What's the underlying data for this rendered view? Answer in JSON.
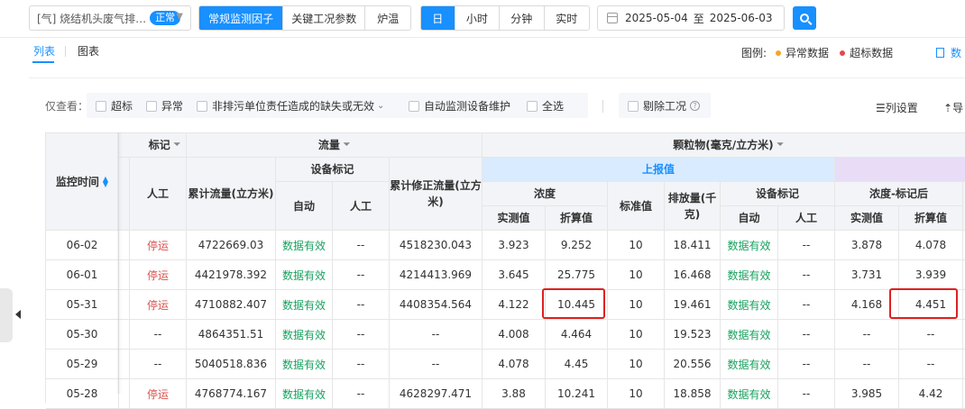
{
  "toolbar": {
    "source_name": "[气] 烧结机头废气排…",
    "source_status": "正常",
    "factor_tabs": [
      "常规监测因子",
      "关键工况参数",
      "炉温"
    ],
    "period_tabs": [
      "日",
      "小时",
      "分钟",
      "实时"
    ],
    "date_start": "2025-05-04",
    "date_sep": "至",
    "date_end": "2025-06-03"
  },
  "view_tabs": {
    "list": "列表",
    "chart": "图表"
  },
  "legend": {
    "title": "图例:",
    "abnormal": "异常数据",
    "exceed": "超标数据",
    "abnormal_color": "#f5a623",
    "exceed_color": "#e5484d"
  },
  "data_link": "数",
  "filters": {
    "label": "仅查看：",
    "items": [
      "超标",
      "异常",
      "非排污单位责任造成的缺失或无效",
      "自动监测设备维护",
      "全选"
    ],
    "exclude": "剔除工况"
  },
  "actions": {
    "column_settings": "列设置",
    "export": "导"
  },
  "table": {
    "headers": {
      "time": "监控时间",
      "mark_partial": "标记",
      "manual": "人工",
      "flow_group": "流量",
      "cum_flow": "累计流量(立方米)",
      "device_mark": "设备标记",
      "auto": "自动",
      "cum_corr_flow": "累计修正流量(立方米)",
      "particle_group": "颗粒物(毫克/立方米)",
      "reported": "上报值",
      "concentration": "浓度",
      "measured": "实测值",
      "converted": "折算值",
      "standard": "标准值",
      "emission": "排放量(千克)",
      "conc_after_mark": "浓度-标记后"
    },
    "rows": [
      {
        "time": "06-02",
        "manual": "停运",
        "cum_flow": "4722669.03",
        "dev_auto": "数据有效",
        "dev_manual": "--",
        "cum_corr": "4518230.043",
        "measured": "3.923",
        "converted": "9.252",
        "standard": "10",
        "emission": "18.411",
        "dev2_auto": "数据有效",
        "dev2_manual": "--",
        "m_measured": "3.878",
        "m_converted": "4.078"
      },
      {
        "time": "06-01",
        "manual": "停运",
        "cum_flow": "4421978.392",
        "dev_auto": "数据有效",
        "dev_manual": "--",
        "cum_corr": "4214413.969",
        "measured": "3.645",
        "converted": "25.775",
        "standard": "10",
        "emission": "16.468",
        "dev2_auto": "数据有效",
        "dev2_manual": "--",
        "m_measured": "3.731",
        "m_converted": "3.939"
      },
      {
        "time": "05-31",
        "manual": "停运",
        "cum_flow": "4710882.407",
        "dev_auto": "数据有效",
        "dev_manual": "--",
        "cum_corr": "4408354.564",
        "measured": "4.122",
        "converted": "10.445",
        "standard": "10",
        "emission": "19.461",
        "dev2_auto": "数据有效",
        "dev2_manual": "--",
        "m_measured": "4.168",
        "m_converted": "4.451"
      },
      {
        "time": "05-30",
        "manual": "--",
        "cum_flow": "4864351.51",
        "dev_auto": "数据有效",
        "dev_manual": "--",
        "cum_corr": "--",
        "measured": "4.008",
        "converted": "4.464",
        "standard": "10",
        "emission": "19.523",
        "dev2_auto": "数据有效",
        "dev2_manual": "--",
        "m_measured": "--",
        "m_converted": "--"
      },
      {
        "time": "05-29",
        "manual": "--",
        "cum_flow": "5040518.836",
        "dev_auto": "数据有效",
        "dev_manual": "--",
        "cum_corr": "--",
        "measured": "4.078",
        "converted": "4.45",
        "standard": "10",
        "emission": "20.556",
        "dev2_auto": "数据有效",
        "dev2_manual": "--",
        "m_measured": "--",
        "m_converted": "--"
      },
      {
        "time": "05-28",
        "manual": "停运",
        "cum_flow": "4768774.167",
        "dev_auto": "数据有效",
        "dev_manual": "--",
        "cum_corr": "4628297.471",
        "measured": "3.88",
        "converted": "10.241",
        "standard": "10",
        "emission": "18.858",
        "dev2_auto": "数据有效",
        "dev2_manual": "--",
        "m_measured": "3.985",
        "m_converted": "4.42"
      }
    ]
  }
}
